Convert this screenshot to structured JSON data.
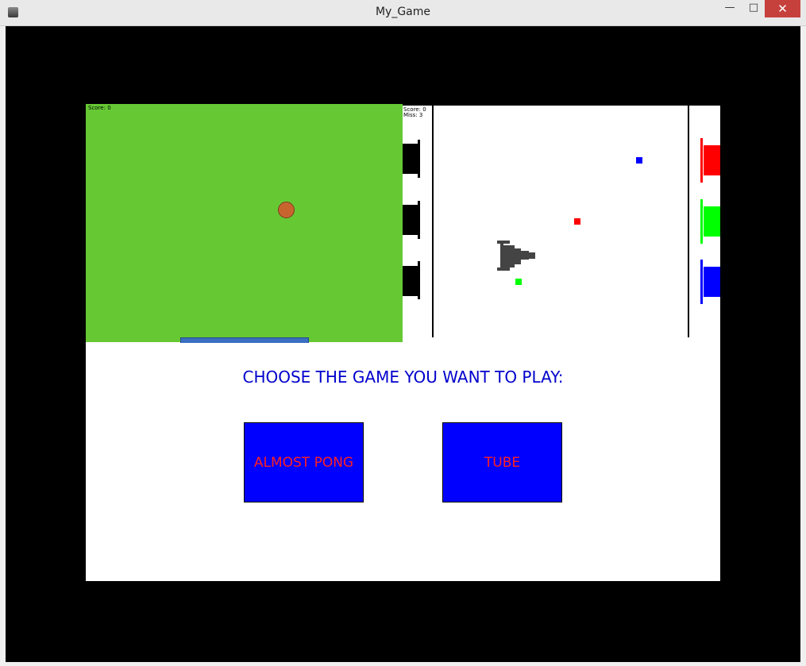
{
  "window": {
    "title": "My_Game"
  },
  "pong": {
    "score_label": "Score: 0"
  },
  "tube": {
    "score_label": "Score: 0",
    "miss_label": "Miss: 3"
  },
  "menu": {
    "prompt": "CHOOSE THE GAME YOU WANT TO PLAY:",
    "prompt_color": "#0000cc",
    "buttons": [
      {
        "label": "ALMOST PONG"
      },
      {
        "label": "TUBE"
      }
    ],
    "button_color": "#0000ff",
    "button_text_color": "#ff2020"
  },
  "colors": {
    "pong_field": "#66c934",
    "ball": "#c8652f",
    "paddle": "#3a6fc1",
    "tube_red": "#ff0000",
    "tube_green": "#00ff00",
    "tube_blue": "#0000ff",
    "close_button": "#c7413c"
  },
  "bullets": [
    "blue",
    "red",
    "green"
  ],
  "icons": [
    "app-icon",
    "minimize-icon",
    "maximize-icon",
    "close-icon"
  ]
}
